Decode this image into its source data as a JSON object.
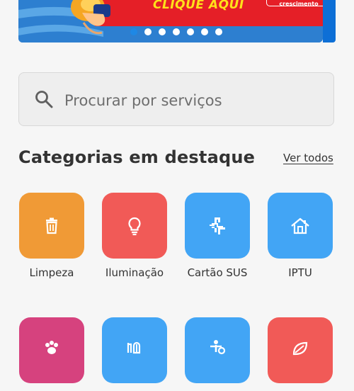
{
  "banner": {
    "cta": "CLIQUE AQUI",
    "tag": "crescimento",
    "slides": 7,
    "active_slide": 1,
    "colors": {
      "red": "#e51f27",
      "yellow": "#ffe11a",
      "blue": "#2d7fd0"
    }
  },
  "search": {
    "placeholder": "Procurar por serviços",
    "icon": "search-icon"
  },
  "section": {
    "title": "Categorias em destaque",
    "see_all": "Ver todos"
  },
  "categories": [
    {
      "label": "Limpeza",
      "color": "#f09a36",
      "icon": "trash-icon"
    },
    {
      "label": "Iluminação",
      "color": "#f15a57",
      "icon": "lightbulb-icon"
    },
    {
      "label": "Cartão SUS",
      "color": "#42a5f5",
      "icon": "health-cross-icon"
    },
    {
      "label": "IPTU",
      "color": "#42a5f5",
      "icon": "house-icon"
    },
    {
      "label": "",
      "color": "#d6427e",
      "icon": "paw-icon"
    },
    {
      "label": "",
      "color": "#42a5f5",
      "icon": "hand-tree-icon"
    },
    {
      "label": "",
      "color": "#42a5f5",
      "icon": "person-weights-icon"
    },
    {
      "label": "",
      "color": "#f15a57",
      "icon": "leaf-icon"
    }
  ]
}
